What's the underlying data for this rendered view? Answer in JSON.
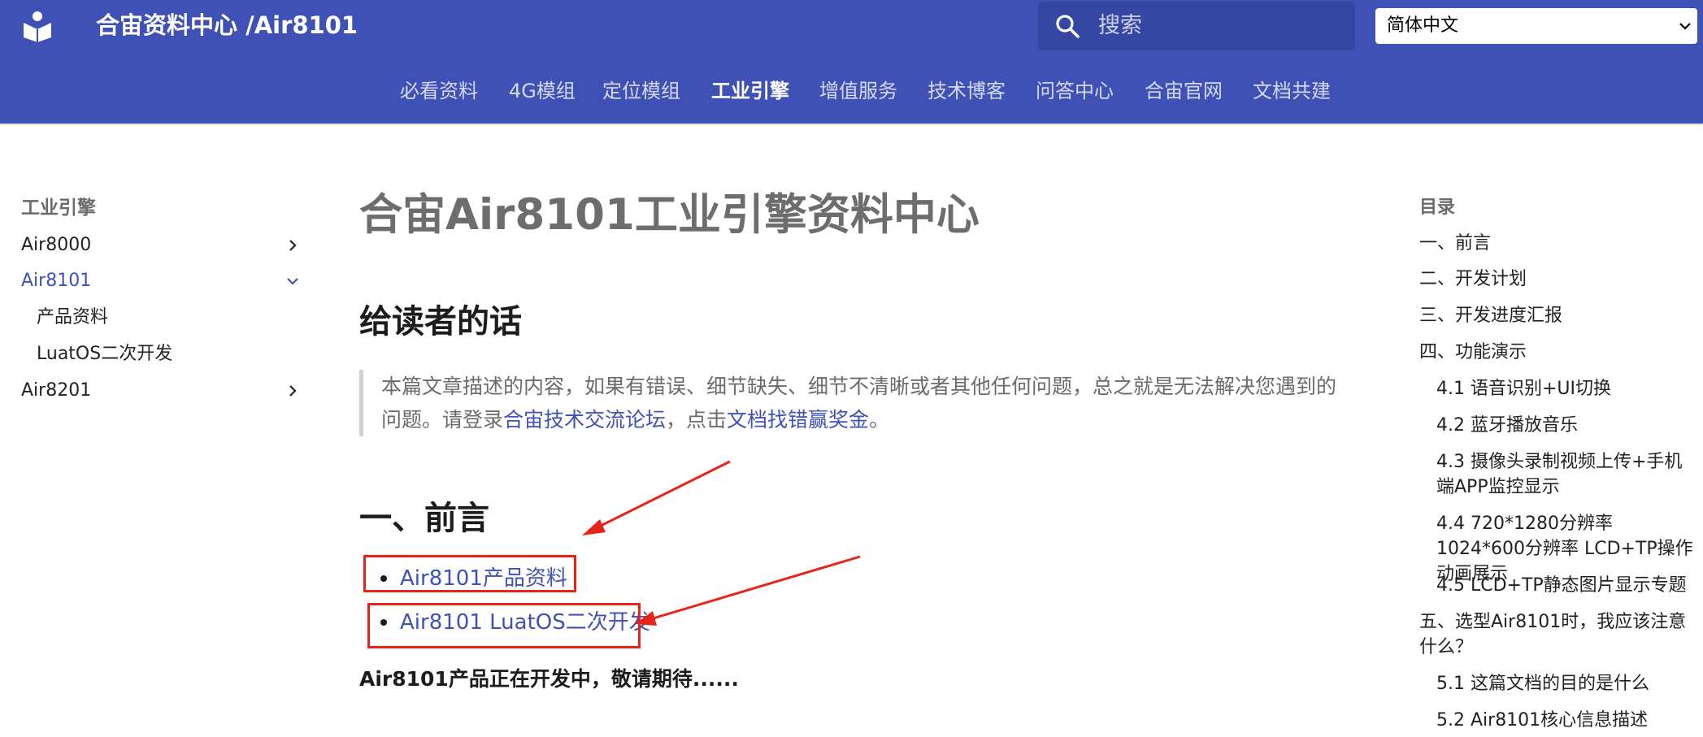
{
  "header": {
    "site_title": "合宙资料中心 /Air8101",
    "search_placeholder": "搜索",
    "language": "简体中文",
    "brand_color": "#3f51b5"
  },
  "tabs": [
    {
      "label": "必看资料",
      "active": false
    },
    {
      "label": "4G模组",
      "active": false
    },
    {
      "label": "定位模组",
      "active": false
    },
    {
      "label": "工业引擎",
      "active": true
    },
    {
      "label": "增值服务",
      "active": false
    },
    {
      "label": "技术博客",
      "active": false
    },
    {
      "label": "问答中心",
      "active": false
    },
    {
      "label": "合宙官网",
      "active": false
    },
    {
      "label": "文档共建",
      "active": false
    }
  ],
  "sidebar": {
    "title": "工业引擎",
    "items": [
      {
        "label": "Air8000",
        "icon": "chevron-right-icon"
      },
      {
        "label": "Air8101",
        "icon": "chevron-down-icon",
        "active": true
      },
      {
        "label": "产品资料"
      },
      {
        "label": "LuatOS二次开发"
      },
      {
        "label": "Air8201",
        "icon": "chevron-right-icon"
      }
    ]
  },
  "main": {
    "title": "合宙Air8101工业引擎资料中心",
    "section1_heading": "给读者的话",
    "quote_text_1": "本篇文章描述的内容，如果有错误、细节缺失、细节不清晰或者其他任何问题，总之就是无法解决您遇到的问题。请登录",
    "quote_link_1": "合宙技术交流论坛",
    "quote_text_2": "，点击",
    "quote_link_2": "文档找错赢奖金",
    "quote_text_3": "。",
    "section2_heading": "一、前言",
    "links": [
      "Air8101产品资料",
      "Air8101 LuatOS二次开发"
    ],
    "note": "Air8101产品正在开发中，敬请期待......"
  },
  "toc": {
    "title": "目录",
    "items": [
      {
        "label": "一、前言",
        "level": 1
      },
      {
        "label": "二、开发计划",
        "level": 1
      },
      {
        "label": "三、开发进度汇报",
        "level": 1
      },
      {
        "label": "四、功能演示",
        "level": 1
      },
      {
        "label": "4.1 语音识别+UI切换",
        "level": 2
      },
      {
        "label": "4.2 蓝牙播放音乐",
        "level": 2
      },
      {
        "label": "4.3 摄像头录制视频上传+手机端APP监控显示",
        "level": 2
      },
      {
        "label": "4.4 720*1280分辨率 1024*600分辨率 LCD+TP操作动画展示",
        "level": 2
      },
      {
        "label": "4.5 LCD+TP静态图片显示专题",
        "level": 2
      },
      {
        "label": "五、选型Air8101时，我应该注意什么？",
        "level": 1
      },
      {
        "label": "5.1 这篇文档的目的是什么",
        "level": 2
      },
      {
        "label": "5.2 Air8101核心信息描述",
        "level": 2
      }
    ]
  },
  "annotation_color": "#e8231c"
}
